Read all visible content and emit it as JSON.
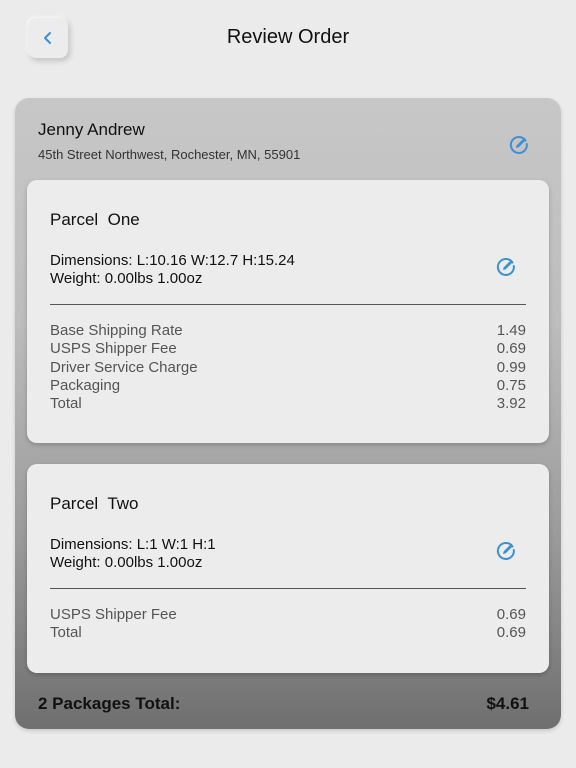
{
  "header": {
    "title": "Review Order"
  },
  "customer": {
    "name": "Jenny Andrew",
    "address": "45th Street Northwest, Rochester, MN, 55901"
  },
  "parcels": [
    {
      "title": "Parcel  One",
      "dimensions": "Dimensions: L:10.16 W:12.7 H:15.24",
      "weight": "Weight: 0.00lbs 1.00oz",
      "charges": [
        {
          "label": "Base Shipping Rate",
          "value": "1.49"
        },
        {
          "label": "USPS Shipper Fee",
          "value": "0.69"
        },
        {
          "label": "Driver Service Charge",
          "value": "0.99"
        },
        {
          "label": "Packaging",
          "value": "0.75"
        },
        {
          "label": "Total",
          "value": "3.92"
        }
      ]
    },
    {
      "title": "Parcel  Two",
      "dimensions": "Dimensions: L:1 W:1 H:1",
      "weight": "Weight: 0.00lbs 1.00oz",
      "charges": [
        {
          "label": "USPS Shipper Fee",
          "value": "0.69"
        },
        {
          "label": "Total",
          "value": "0.69"
        }
      ]
    }
  ],
  "summary": {
    "label": "2 Packages Total:",
    "amount": "$4.61"
  },
  "icons": {
    "back": "chevron-left-icon",
    "edit": "edit-icon"
  },
  "colors": {
    "accent": "#3d8fd6"
  }
}
